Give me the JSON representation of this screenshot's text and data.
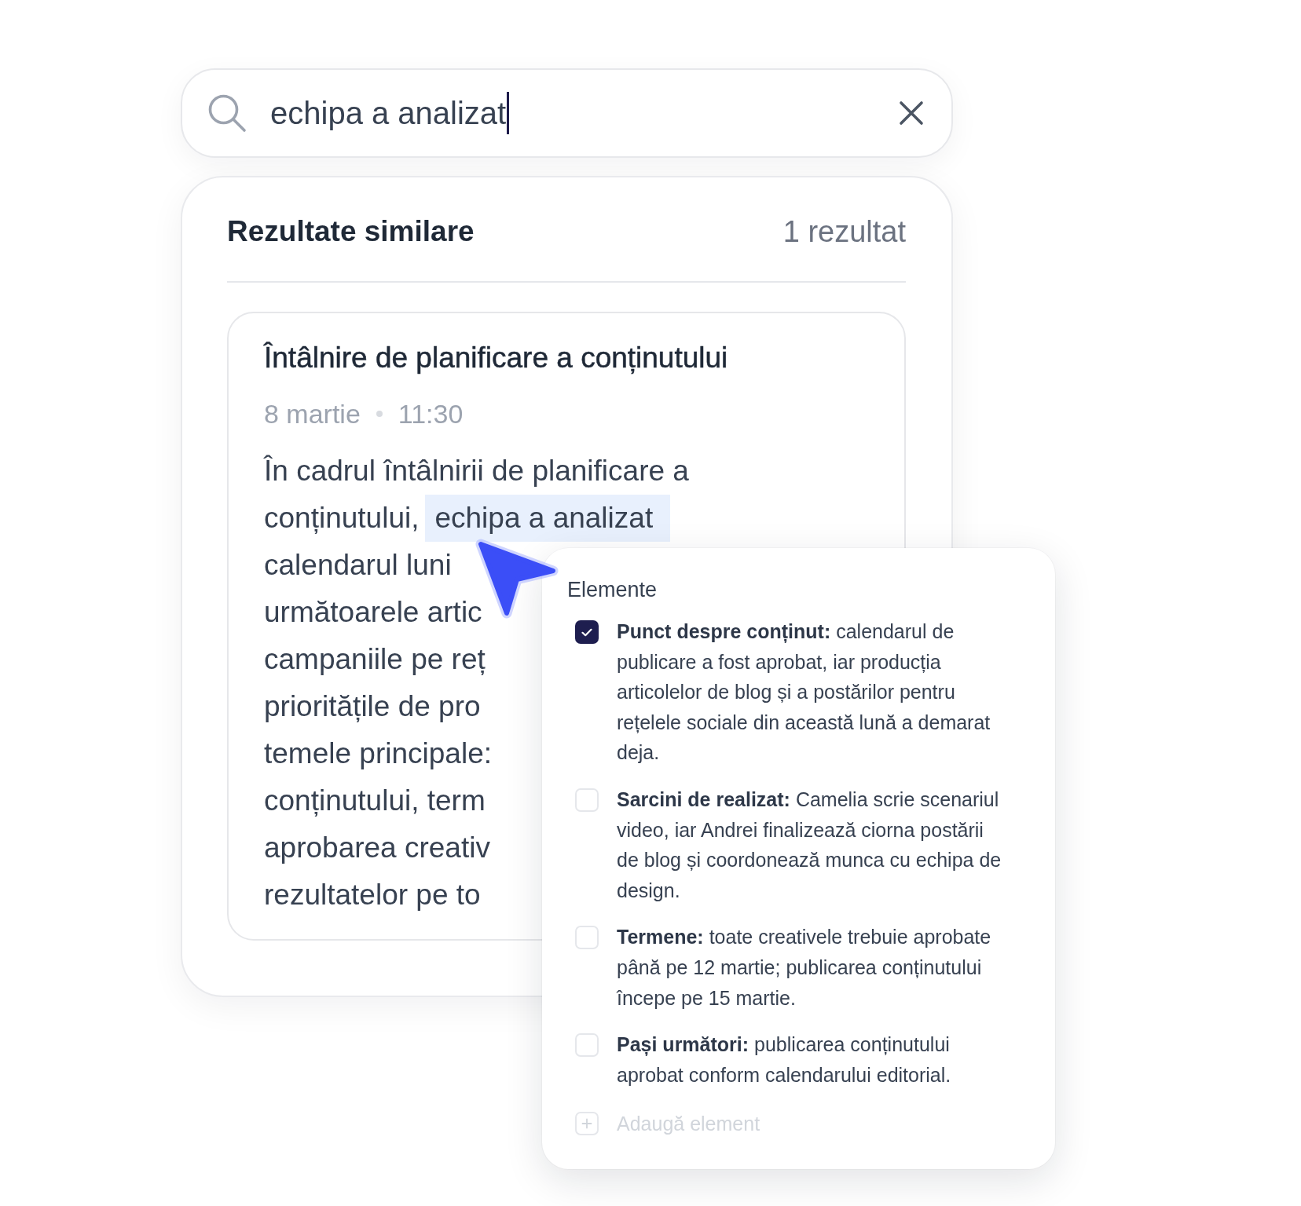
{
  "search": {
    "value": "echipa a analizat",
    "focused": true
  },
  "results": {
    "title": "Rezultate similare",
    "count": "1 rezultat",
    "items": [
      {
        "title": "Întâlnire de planificare a conținutului",
        "date": "8 martie",
        "time": "11:30",
        "summary_lines": [
          [
            {
              "text": "În cadrul întâlnirii de planificare a",
              "highlighted": false
            }
          ],
          [
            {
              "text": "conținutului,",
              "highlighted": false
            },
            {
              "text": "echipa a analizat",
              "highlighted": true
            }
          ],
          [
            {
              "text": "calendarul luni",
              "highlighted": false
            }
          ],
          [
            {
              "text": "următoarele artic",
              "highlighted": false
            }
          ],
          [
            {
              "text": "campaniile pe reț",
              "highlighted": false
            }
          ],
          [
            {
              "text": "prioritățile de pro",
              "highlighted": false
            }
          ],
          [
            {
              "text": "temele principale:",
              "highlighted": false
            }
          ],
          [
            {
              "text": "conținutului, term",
              "highlighted": false
            }
          ],
          [
            {
              "text": "aprobarea creativ",
              "highlighted": false
            }
          ],
          [
            {
              "text": "rezultatelor pe to",
              "highlighted": false
            }
          ]
        ]
      }
    ]
  },
  "checklist": {
    "title": "Elemente",
    "items": [
      {
        "text": "**Punct despre conținut:** calendarul de publicare a fost aprobat, iar producția articolelor de blog și a postărilor pentru rețelele sociale din această lună a demarat deja.",
        "checked": true
      },
      {
        "text": "**Sarcini de realizat:** Camelia scrie scenariul video, iar Andrei finalizează ciorna postării de blog și coordonează munca cu echipa de design.",
        "checked": false
      },
      {
        "text": "**Termene:** toate creativele trebuie aprobate până pe 12 martie; publicarea conținutului începe pe 15 martie.",
        "checked": false
      },
      {
        "text": "**Pași următori:** publicarea conținutului aprobat conform calendarului editorial.",
        "checked": false
      }
    ],
    "add_label": "Adaugă element"
  }
}
